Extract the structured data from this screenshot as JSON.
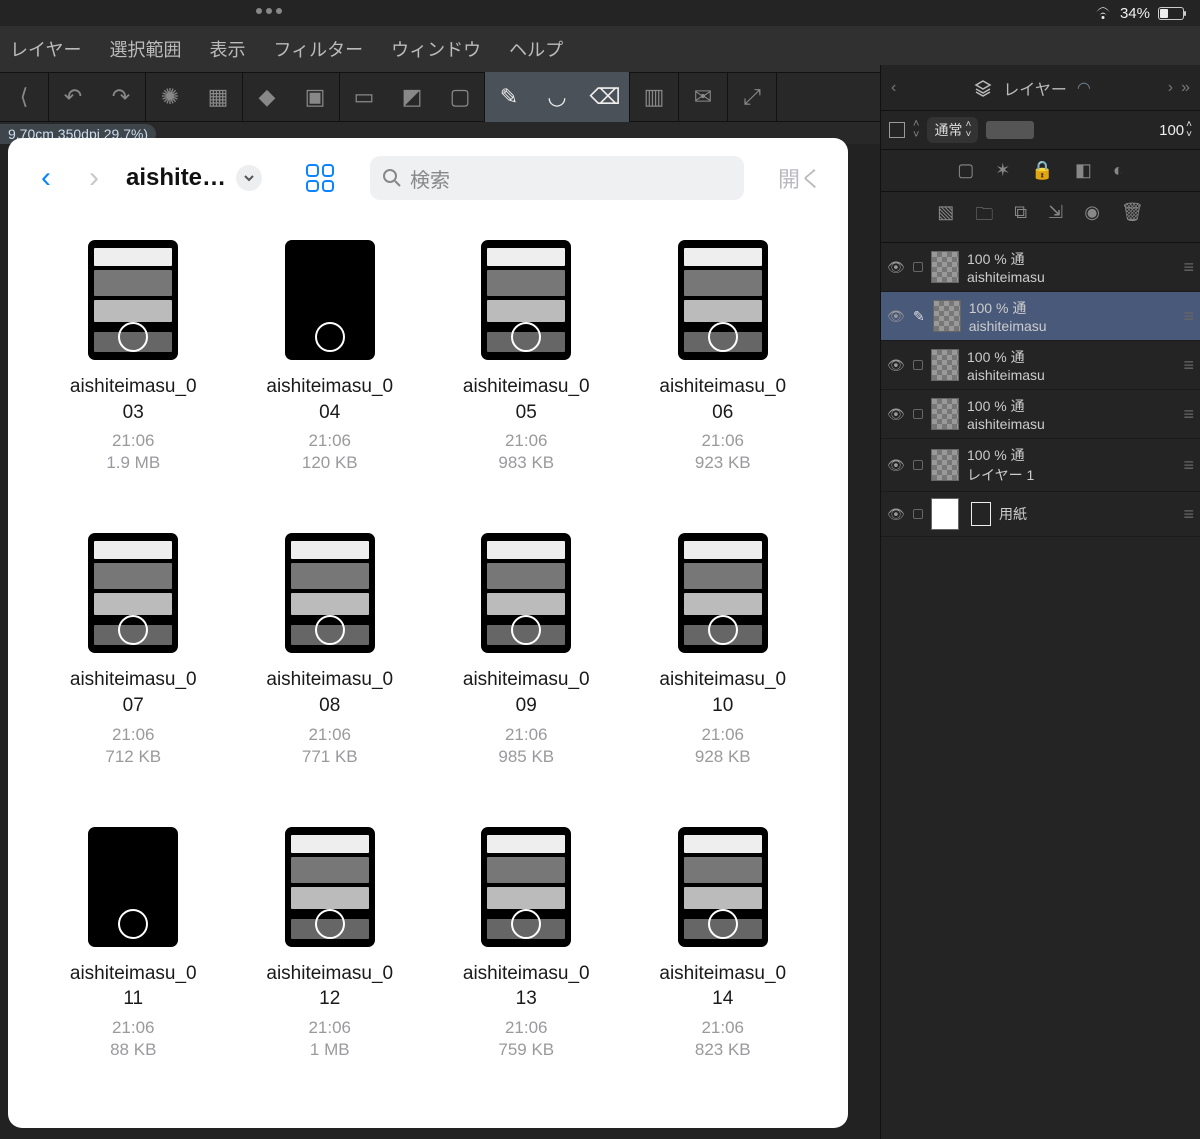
{
  "status": {
    "battery_pct": "34%"
  },
  "menubar": {
    "items": [
      "レイヤー",
      "選択範囲",
      "表示",
      "フィルター",
      "ウィンドウ",
      "ヘルプ"
    ]
  },
  "doc_info": "9.70cm 350dpi 29.7%)",
  "picker": {
    "folder": "aishite…",
    "search_placeholder": "検索",
    "open_label": "開く",
    "files": [
      {
        "name": "aishiteimasu_003",
        "time": "21:06",
        "size": "1.9 MB",
        "sparse": false
      },
      {
        "name": "aishiteimasu_004",
        "time": "21:06",
        "size": "120 KB",
        "sparse": true
      },
      {
        "name": "aishiteimasu_005",
        "time": "21:06",
        "size": "983 KB",
        "sparse": false
      },
      {
        "name": "aishiteimasu_006",
        "time": "21:06",
        "size": "923 KB",
        "sparse": false
      },
      {
        "name": "aishiteimasu_007",
        "time": "21:06",
        "size": "712 KB",
        "sparse": false
      },
      {
        "name": "aishiteimasu_008",
        "time": "21:06",
        "size": "771 KB",
        "sparse": false
      },
      {
        "name": "aishiteimasu_009",
        "time": "21:06",
        "size": "985 KB",
        "sparse": false
      },
      {
        "name": "aishiteimasu_010",
        "time": "21:06",
        "size": "928 KB",
        "sparse": false
      },
      {
        "name": "aishiteimasu_011",
        "time": "21:06",
        "size": "88 KB",
        "sparse": true
      },
      {
        "name": "aishiteimasu_012",
        "time": "21:06",
        "size": "1 MB",
        "sparse": false
      },
      {
        "name": "aishiteimasu_013",
        "time": "21:06",
        "size": "759 KB",
        "sparse": false
      },
      {
        "name": "aishiteimasu_014",
        "time": "21:06",
        "size": "823 KB",
        "sparse": false
      }
    ]
  },
  "layers_panel": {
    "tab_label": "レイヤー",
    "blend_mode": "通常",
    "opacity": "100",
    "layers": [
      {
        "opacity": "100 %",
        "blend": "通",
        "name": "aishiteimasu",
        "selected": false,
        "thumb": "checker"
      },
      {
        "opacity": "100 %",
        "blend": "通",
        "name": "aishiteimasu",
        "selected": true,
        "thumb": "checker"
      },
      {
        "opacity": "100 %",
        "blend": "通",
        "name": "aishiteimasu",
        "selected": false,
        "thumb": "checker"
      },
      {
        "opacity": "100 %",
        "blend": "通",
        "name": "aishiteimasu",
        "selected": false,
        "thumb": "checker"
      },
      {
        "opacity": "100 %",
        "blend": "通",
        "name": "レイヤー 1",
        "selected": false,
        "thumb": "checker"
      },
      {
        "opacity": "",
        "blend": "",
        "name": "用紙",
        "selected": false,
        "thumb": "white"
      }
    ]
  }
}
